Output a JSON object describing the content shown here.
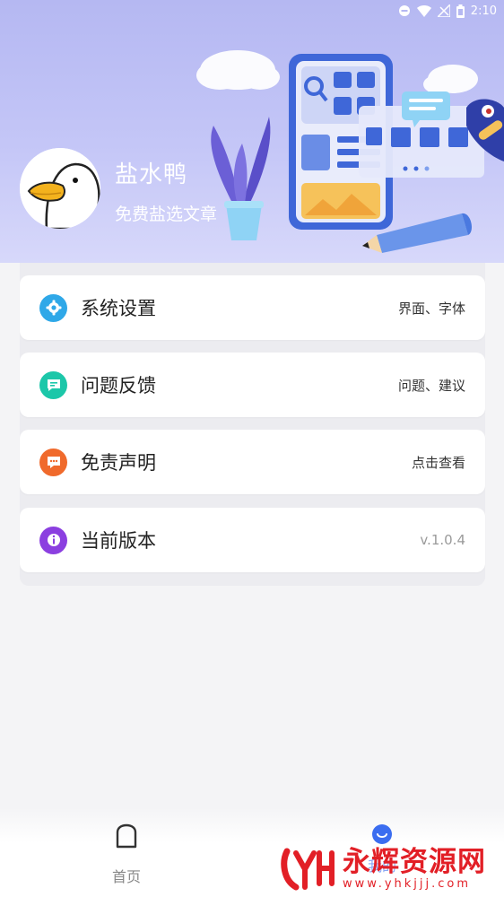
{
  "status_bar": {
    "time": "2:10"
  },
  "profile": {
    "name": "盐水鸭",
    "subtitle": "免费盐选文章"
  },
  "menu": [
    {
      "label": "系统设置",
      "value": "界面、字体",
      "icon": "gear-icon",
      "color": "#2fa8e8"
    },
    {
      "label": "问题反馈",
      "value": "问题、建议",
      "icon": "message-icon",
      "color": "#1cc7a9"
    },
    {
      "label": "免责声明",
      "value": "点击查看",
      "icon": "chat-dots-icon",
      "color": "#f06a2c"
    },
    {
      "label": "当前版本",
      "value": "v.1.0.4",
      "icon": "info-icon",
      "color": "#8b3fe0"
    }
  ],
  "nav": {
    "home_label": "首页",
    "mine_label": "我的"
  },
  "watermark": {
    "title": "永辉资源网",
    "url": "www.yhkjjj.com"
  },
  "colors": {
    "header_bg": "#b5b8f2",
    "active_nav": "#3b6df0",
    "watermark": "#e21f26"
  }
}
